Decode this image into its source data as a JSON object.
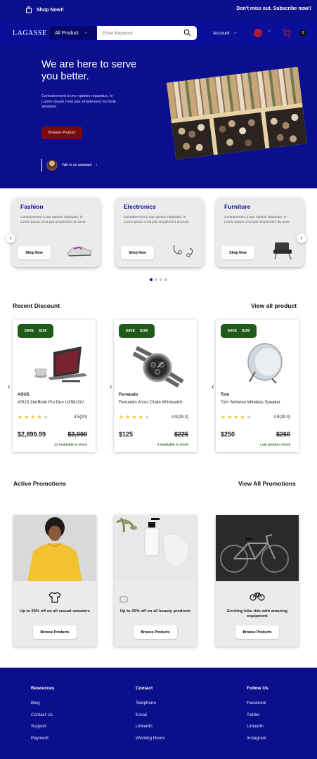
{
  "topbar": {
    "shop_now": "Shop Now!!",
    "subscribe": "Don't miss out. Subscribe now!!",
    "icon": "shop-bag-icon"
  },
  "nav": {
    "logo": "LAGASSE",
    "category_select": "All Product",
    "search_placeholder": "Enter Keyword",
    "account": "Account",
    "cart_count": "0"
  },
  "hero": {
    "headline": "We are here to serve you better.",
    "description": "Contrairement à une opinion répandue, le Lorem Ipsum n'est pas simplement du texte aléatoire.",
    "cta": "Browse Product",
    "talk": "Talk to an assistant"
  },
  "categories": [
    {
      "title": "Fashion",
      "desc": "Contrairement à une opinion répandue, le Lorem Ipsum n'est pas simplement du texte",
      "button": "Shop Now"
    },
    {
      "title": "Electronics",
      "desc": "Contrairement à une opinion répandue, le Lorem Ipsum n'est pas simplement du texte",
      "button": "Shop Now"
    },
    {
      "title": "Furniture",
      "desc": "Contrairement à une opinion répandue, le Lorem Ipsum n'est pas simplement du texte",
      "button": "Shop Now"
    }
  ],
  "discount": {
    "title": "Recent Discount",
    "view_all": "View all product",
    "products": [
      {
        "save": "SAVE",
        "amount": "$100",
        "brand": "ASUS",
        "name": "ASUS ZenBook Pro Duo UX581GV",
        "rating": "4.5(20)",
        "stars": 4,
        "price": "$2,899.99",
        "old_price": "$3,000",
        "stock": "22 Available in stock"
      },
      {
        "save": "SAVE",
        "amount": "$100",
        "brand": "Fernando",
        "name": "Fernando Arcos Chain Wristwatch",
        "rating": "4.9(29.3)",
        "stars": 4,
        "price": "$125",
        "old_price": "$225",
        "stock": "4 Available in stock"
      },
      {
        "save": "SAVE",
        "amount": "$100",
        "brand": "Tom",
        "name": "Tom Swinnen Wireless Speaker",
        "rating": "4.9(29.3)",
        "stars": 4,
        "price": "$250",
        "old_price": "$260",
        "stock": "Last product stock"
      }
    ]
  },
  "promotions": {
    "title": "Active Promotions",
    "view_all": "View All Promotions",
    "items": [
      {
        "text": "Up to 25% off on all casual sweaters",
        "button": "Browse Products",
        "icon": "shirt-icon"
      },
      {
        "text": "Up to 25% off on all beauty products",
        "button": "Browse Products",
        "icon": "beauty-icon"
      },
      {
        "text": "Exciting bike ride with amazing equipment",
        "button": "Browse Products",
        "icon": "bicycle-icon"
      }
    ]
  },
  "footer": {
    "resources": {
      "title": "Resources",
      "links": [
        "Blog",
        "Contact Us",
        "Support",
        "Payment"
      ]
    },
    "contact": {
      "title": "Contact",
      "links": [
        "Telephone",
        "Email",
        "LinkedIn",
        "Working Hours"
      ]
    },
    "follow": {
      "title": "Follow Us",
      "links": [
        "Facebook",
        "Twitter",
        "LinkedIn",
        "Instagram"
      ]
    }
  },
  "colors": {
    "brand_blue": "#0b0f8c",
    "cta_red": "#7b0a0a",
    "save_green": "#1f5a1a",
    "star_yellow": "#f3c623"
  }
}
